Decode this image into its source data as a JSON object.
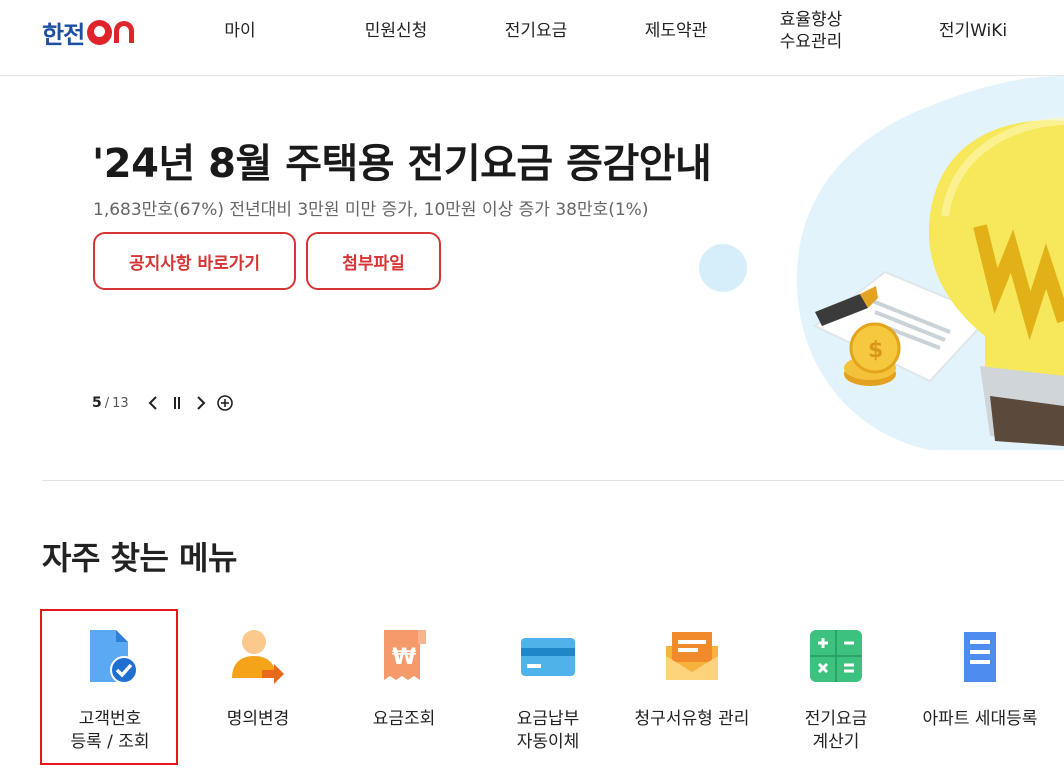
{
  "header": {
    "logo_text": "한전",
    "logo_suffix": "ON",
    "nav": [
      "마이",
      "민원신청",
      "전기요금",
      "제도약관",
      "효율향상\n수요관리",
      "전기WiKi"
    ]
  },
  "hero": {
    "title": "'24년 8월 주택용 전기요금 증감안내",
    "subtitle": "1,683만호(67%) 전년대비 3만원 미만 증가, 10만원 이상 증가 38만호(1%)",
    "btn_notice": "공지사항 바로가기",
    "btn_attach": "첨부파일",
    "pager_current": "5",
    "pager_sep": "/",
    "pager_total": "13"
  },
  "section": {
    "title": "자주 찾는 메뉴"
  },
  "menu": [
    {
      "label": "고객번호\n등록 / 조회",
      "icon": "document-check-icon"
    },
    {
      "label": "명의변경",
      "icon": "person-transfer-icon"
    },
    {
      "label": "요금조회",
      "icon": "receipt-won-icon"
    },
    {
      "label": "요금납부\n자동이체",
      "icon": "card-icon"
    },
    {
      "label": "청구서유형 관리",
      "icon": "envelope-icon"
    },
    {
      "label": "전기요금\n계산기",
      "icon": "calculator-icon"
    },
    {
      "label": "아파트 세대등록",
      "icon": "apartment-icon"
    }
  ],
  "colors": {
    "brand_blue": "#1d4fa3",
    "brand_red": "#e0242b",
    "button_red": "#d63535",
    "highlight": "#e8161c"
  }
}
